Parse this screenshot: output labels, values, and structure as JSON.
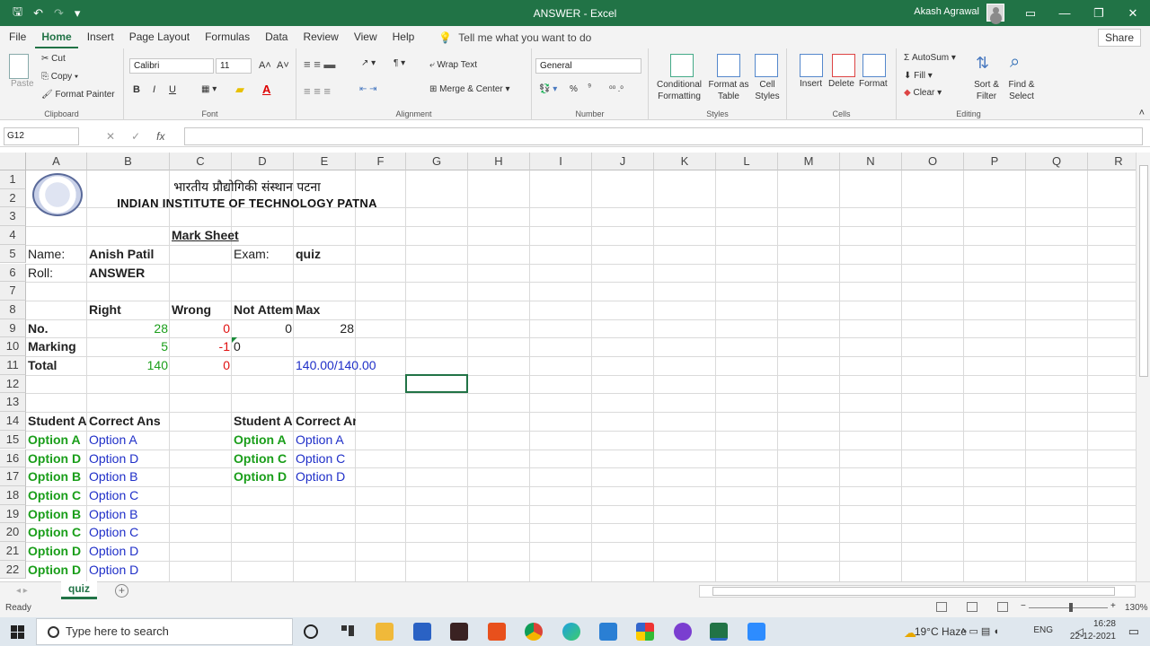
{
  "window": {
    "title": "ANSWER  -  Excel",
    "user": "Akash Agrawal",
    "minimize": "—",
    "restore": "❐",
    "close": "✕",
    "ribbon_display": "▭"
  },
  "tabs": [
    "File",
    "Home",
    "Insert",
    "Page Layout",
    "Formulas",
    "Data",
    "Review",
    "View",
    "Help"
  ],
  "tell_me": "Tell me what you want to do",
  "share": "Share",
  "ribbon": {
    "clipboard": {
      "label": "Clipboard",
      "paste": "Paste",
      "cut": "Cut",
      "copy": "Copy",
      "format_painter": "Format Painter"
    },
    "font": {
      "label": "Font",
      "name": "Calibri",
      "size": "11",
      "bold": "B",
      "italic": "I",
      "underline": "U"
    },
    "alignment": {
      "label": "Alignment",
      "wrap_text": "Wrap Text",
      "merge_center": "Merge & Center"
    },
    "number": {
      "label": "Number",
      "format": "General",
      "percent": "%",
      "comma": "⁹"
    },
    "styles": {
      "label": "Styles",
      "conditional": "Conditional Formatting",
      "format_table": "Format as Table",
      "cell_styles": "Cell Styles"
    },
    "cells": {
      "label": "Cells",
      "insert": "Insert",
      "delete": "Delete",
      "format": "Format"
    },
    "editing": {
      "label": "Editing",
      "autosum": "AutoSum",
      "fill": "Fill",
      "clear": "Clear",
      "sort_filter": "Sort & Filter",
      "find_select": "Find & Select"
    }
  },
  "formula_bar": {
    "name_box": "G12",
    "fx": "fx",
    "cancel": "✕",
    "enter": "✓",
    "value": ""
  },
  "columns": [
    "A",
    "B",
    "C",
    "D",
    "E",
    "F",
    "G",
    "H",
    "I",
    "J",
    "K",
    "L",
    "M",
    "N",
    "O",
    "P",
    "Q",
    "R"
  ],
  "rows": [
    "1",
    "2",
    "3",
    "4",
    "5",
    "6",
    "7",
    "8",
    "9",
    "10",
    "11",
    "12",
    "13",
    "14",
    "15",
    "16",
    "17",
    "18",
    "19",
    "20",
    "21",
    "22"
  ],
  "sheet": {
    "hindi_title": "भारतीय प्रौद्योगिकी संस्थान पटना",
    "institute": "INDIAN INSTITUTE OF TECHNOLOGY PATNA",
    "mark_sheet": "Mark Sheet",
    "name_label": "Name:",
    "name_value": "Anish Patil",
    "exam_label": "Exam:",
    "exam_value": "quiz",
    "roll_label": "Roll:",
    "roll_value": "ANSWER",
    "hdr_right": "Right",
    "hdr_wrong": "Wrong",
    "hdr_not_attempted": "Not Attem",
    "hdr_max": "Max",
    "no_label": "No.",
    "no_right": "28",
    "no_wrong": "0",
    "no_not_attempted": "0",
    "no_max": "28",
    "marking_label": "Marking",
    "marking_right": "5",
    "marking_wrong": "-1",
    "marking_not_attempted": "0",
    "total_label": "Total",
    "total_right": "140",
    "total_wrong": "0",
    "total_score": "140.00/140.00",
    "student_ans_hdr": "Student A",
    "correct_ans_hdr": "Correct Ans",
    "left_answers": [
      {
        "student": "Option A",
        "correct": "Option A"
      },
      {
        "student": "Option D",
        "correct": "Option D"
      },
      {
        "student": "Option B",
        "correct": "Option B"
      },
      {
        "student": "Option C",
        "correct": "Option C"
      },
      {
        "student": "Option B",
        "correct": "Option B"
      },
      {
        "student": "Option C",
        "correct": "Option C"
      },
      {
        "student": "Option D",
        "correct": "Option D"
      },
      {
        "student": "Option D",
        "correct": "Option D"
      }
    ],
    "right_answers": [
      {
        "student": "Option A",
        "correct": "Option A"
      },
      {
        "student": "Option C",
        "correct": "Option C"
      },
      {
        "student": "Option D",
        "correct": "Option D"
      }
    ]
  },
  "sheet_tab": "quiz",
  "status": {
    "ready": "Ready",
    "zoom": "130%"
  },
  "taskbar": {
    "search_placeholder": "Type here to search",
    "weather": "19°C  Haze",
    "lang": "ENG",
    "time": "16:28",
    "date": "22-12-2021"
  },
  "colors": {
    "excel_green": "#217346",
    "answer_green": "#1a9e1a",
    "answer_blue": "#1f2fc8",
    "negative_red": "#e01010"
  }
}
